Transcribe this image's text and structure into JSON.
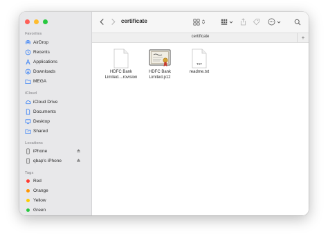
{
  "window": {
    "title": "certificate"
  },
  "path_bar": {
    "label": "certificate",
    "add_label": "+"
  },
  "sidebar": {
    "favorites_title": "Favorites",
    "favorites": [
      {
        "label": "AirDrop",
        "icon": "airdrop-icon"
      },
      {
        "label": "Recents",
        "icon": "clock-icon"
      },
      {
        "label": "Applications",
        "icon": "applications-icon"
      },
      {
        "label": "Downloads",
        "icon": "download-icon"
      },
      {
        "label": "MEGA",
        "icon": "folder-icon"
      }
    ],
    "icloud_title": "iCloud",
    "icloud": [
      {
        "label": "iCloud Drive",
        "icon": "cloud-icon"
      },
      {
        "label": "Documents",
        "icon": "document-icon"
      },
      {
        "label": "Desktop",
        "icon": "desktop-icon"
      },
      {
        "label": "Shared",
        "icon": "shared-folder-icon"
      }
    ],
    "locations_title": "Locations",
    "locations": [
      {
        "label": "iPhone",
        "icon": "phone-icon"
      },
      {
        "label": "qbap's iPhone",
        "icon": "phone-icon"
      }
    ],
    "tags_title": "Tags",
    "tags": [
      {
        "label": "Red",
        "color": "#ff3b30"
      },
      {
        "label": "Orange",
        "color": "#ff9500"
      },
      {
        "label": "Yellow",
        "color": "#ffcc00"
      },
      {
        "label": "Green",
        "color": "#28c840"
      }
    ]
  },
  "files": [
    {
      "name_line1": "HDFC Bank",
      "name_line2": "Limited....rovision",
      "icon": "blank-document-icon"
    },
    {
      "name_line1": "HDFC Bank",
      "name_line2": "Limited.p12",
      "icon": "certificate-icon"
    },
    {
      "name_line1": "readme.txt",
      "name_line2": "",
      "icon": "text-document-icon",
      "badge": "TXT"
    }
  ]
}
